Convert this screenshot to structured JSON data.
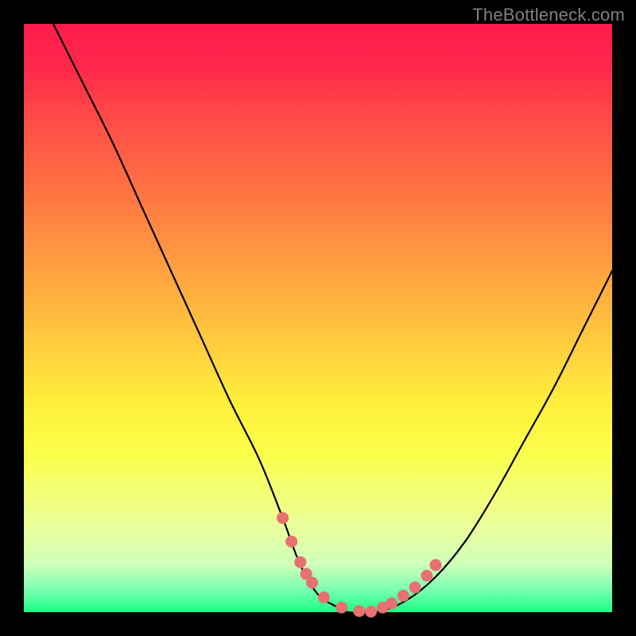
{
  "watermark": "TheBottleneck.com",
  "chart_data": {
    "type": "line",
    "title": "",
    "xlabel": "",
    "ylabel": "",
    "xlim": [
      0,
      100
    ],
    "ylim": [
      0,
      100
    ],
    "series": [
      {
        "name": "bottleneck-curve",
        "x": [
          5,
          10,
          15,
          20,
          25,
          30,
          35,
          40,
          44,
          47,
          50,
          53,
          55,
          60,
          65,
          70,
          75,
          80,
          85,
          90,
          95,
          100
        ],
        "y": [
          100,
          90,
          80,
          69,
          58,
          47,
          36,
          26,
          16,
          8,
          3,
          1,
          0,
          0,
          2,
          6,
          12,
          20,
          29,
          38,
          48,
          58
        ]
      }
    ],
    "markers": {
      "name": "highlight-points",
      "x": [
        44.0,
        45.5,
        47.0,
        48.0,
        49.0,
        51.0,
        54.0,
        57.0,
        59.0,
        61.0,
        62.5,
        64.5,
        66.5,
        68.5,
        70.0
      ],
      "y": [
        16.0,
        12.0,
        8.5,
        6.5,
        5.0,
        2.5,
        0.8,
        0.2,
        0.1,
        0.8,
        1.5,
        2.8,
        4.2,
        6.2,
        8.0
      ],
      "color": "#e87070"
    },
    "background_gradient": {
      "top": "#ff1a4d",
      "bottom": "#1aff83"
    }
  }
}
